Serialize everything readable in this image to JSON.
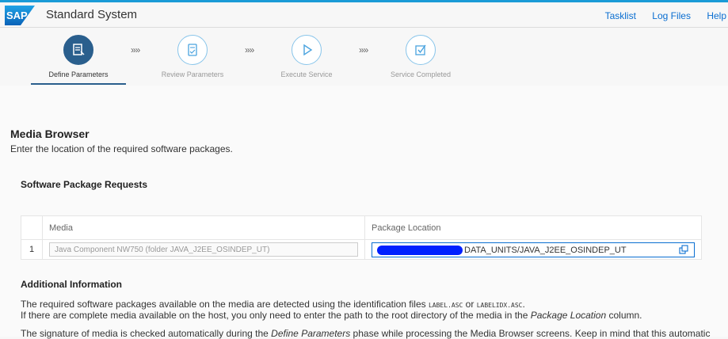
{
  "header": {
    "logo_text": "SAP",
    "title": "Standard System",
    "links": [
      "Tasklist",
      "Log Files",
      "Help"
    ],
    "brand_color": "#0a6ed1"
  },
  "wizard": {
    "steps": [
      {
        "label": "Define Parameters",
        "state": "active",
        "icon": "form-edit-icon"
      },
      {
        "label": "Review Parameters",
        "state": "inactive",
        "icon": "document-check-icon"
      },
      {
        "label": "Execute Service",
        "state": "inactive",
        "icon": "play-icon"
      },
      {
        "label": "Service Completed",
        "state": "inactive",
        "icon": "checkbox-icon"
      }
    ],
    "separator": "»»"
  },
  "main": {
    "title": "Media Browser",
    "description": "Enter the location of the required software packages.",
    "requests_title": "Software Package Requests",
    "table": {
      "headers": [
        "",
        "Media",
        "Package Location"
      ],
      "rows": [
        {
          "num": "1",
          "media": "Java Component NW750 (folder JAVA_J2EE_OSINDEP_UT)",
          "location_visible": "DATA_UNITS/JAVA_J2EE_OSINDEP_UT"
        }
      ]
    },
    "additional_title": "Additional Information",
    "para1_a": "The required software packages available on the media are detected using the identification files ",
    "para1_file1": "LABEL.ASC",
    "para1_or": " or ",
    "para1_file2": "LABELIDX.ASC",
    "para1_end": ".",
    "para2_a": "If there are complete media available on the host, you only need to enter the path to the root directory of the media in the ",
    "para2_em": "Package Location",
    "para2_b": " column.",
    "para3_a": "The signature of media is checked automatically during the ",
    "para3_em": "Define Parameters",
    "para3_b": " phase while processing the Media Browser screens. Keep in mind that this automatic"
  }
}
